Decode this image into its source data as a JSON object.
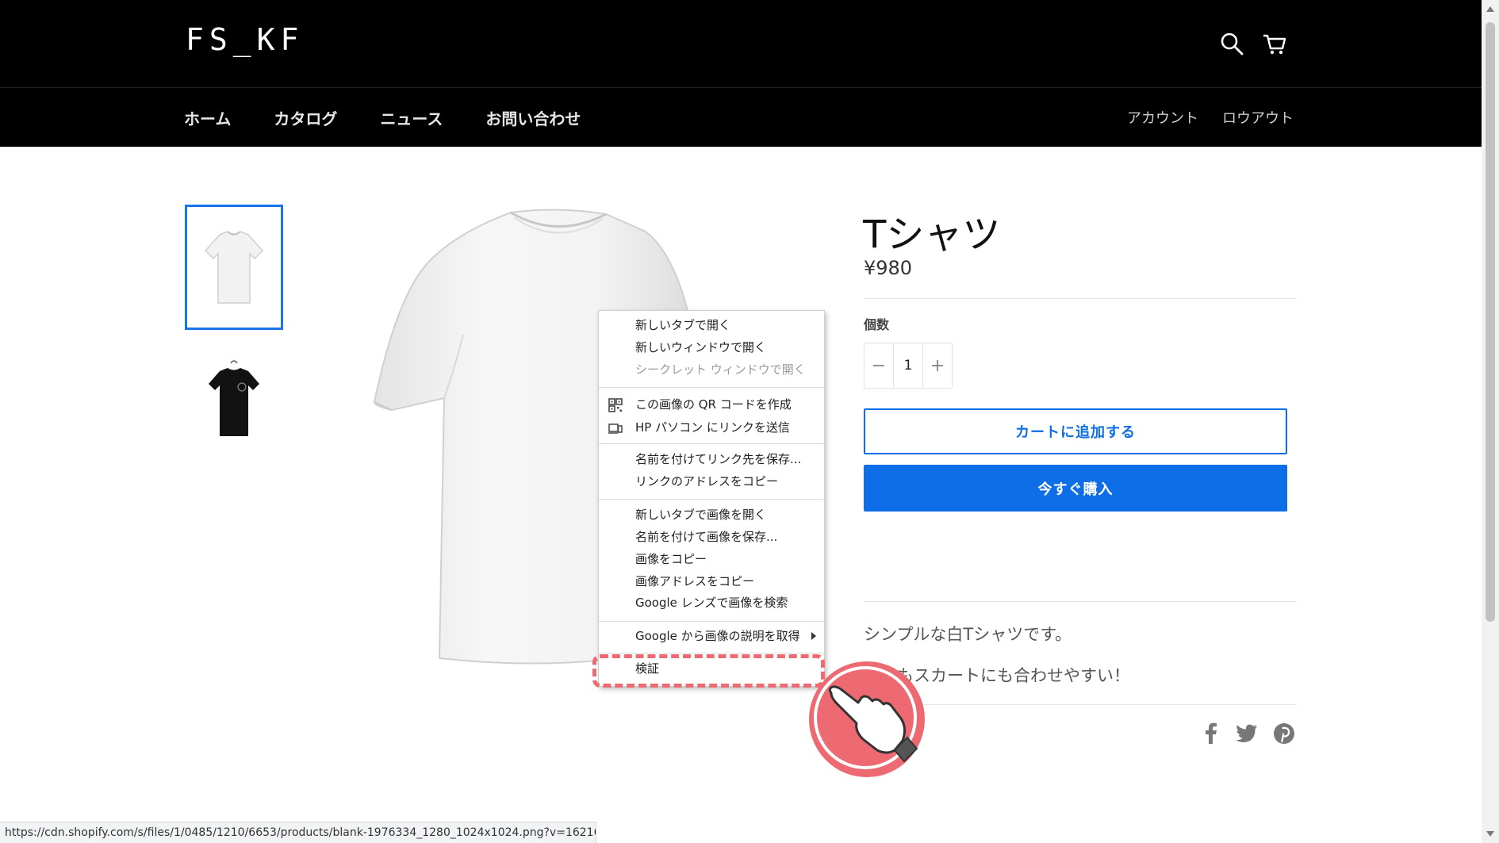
{
  "header": {
    "logo": "FS_KF",
    "nav": [
      "ホーム",
      "カタログ",
      "ニュース",
      "お問い合わせ"
    ],
    "account": "アカウント",
    "logout": "ロウアウト",
    "icons": [
      "search-icon",
      "cart-icon"
    ]
  },
  "product": {
    "title": "Tシャツ",
    "price": "¥980",
    "quantity_label": "個数",
    "quantity_minus": "−",
    "quantity_value": "1",
    "quantity_plus": "+",
    "add_to_cart": "カートに追加する",
    "buy_now": "今すぐ購入",
    "description_line1": "シンプルな白Tシャツです。",
    "description_line2": "ッにもスカートにも合わせやすい！",
    "share_icons": [
      "facebook-icon",
      "twitter-icon",
      "pinterest-icon"
    ]
  },
  "thumbnails": [
    "white-tshirt",
    "black-tshirt"
  ],
  "context_menu": {
    "items": [
      "新しいタブで開く",
      "新しいウィンドウで開く",
      "シークレット ウィンドウで開く",
      "この画像の QR コードを作成",
      "HP パソコン にリンクを送信",
      "名前を付けてリンク先を保存...",
      "リンクのアドレスをコピー",
      "新しいタブで画像を開く",
      "名前を付けて画像を保存...",
      "画像をコピー",
      "画像アドレスをコピー",
      "Google レンズで画像を検索",
      "Google から画像の説明を取得",
      "検証"
    ],
    "highlight_color": "#ee6a72"
  },
  "status_url": "https://cdn.shopify.com/s/files/1/0485/1210/6653/products/blank-1976334_1280_1024x1024.png?v=1621688346",
  "colors": {
    "accent": "#0d6ee8",
    "header_bg": "#000000",
    "annotation": "#ee6a72"
  }
}
